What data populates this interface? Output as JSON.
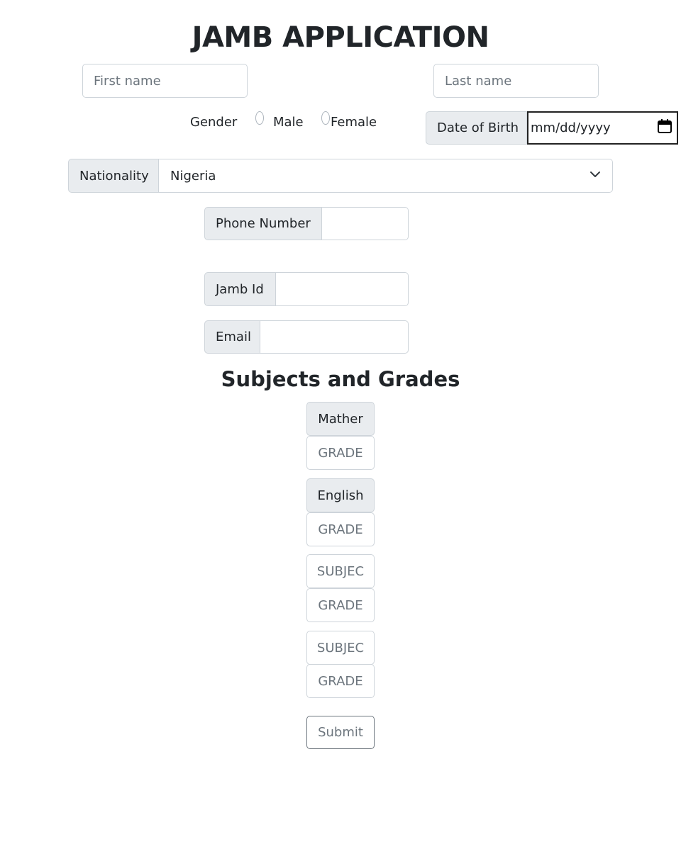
{
  "page": {
    "title": "JAMB APPLICATION",
    "subtitle": "Subjects and Grades"
  },
  "names": {
    "first_placeholder": "First name",
    "last_placeholder": "Last name"
  },
  "gender": {
    "label": "Gender",
    "options": [
      "Male",
      "Female"
    ]
  },
  "dob": {
    "label": "Date of Birth",
    "value": "mm/dd/yyyy",
    "icon": "calendar-icon"
  },
  "nationality": {
    "label": "Nationality",
    "selected": "Nigeria",
    "icon": "chevron-down-icon"
  },
  "phone": {
    "label": "Phone Number",
    "value": ""
  },
  "jamb": {
    "label": "Jamb Id",
    "value": ""
  },
  "email": {
    "label": "Email",
    "value": ""
  },
  "subjects": [
    {
      "subject": "Mather",
      "grade_placeholder": "GRADE"
    },
    {
      "subject": "English",
      "grade_placeholder": "GRADE"
    },
    {
      "subject_placeholder": "SUBJEC",
      "grade_placeholder": "GRADE"
    },
    {
      "subject_placeholder": "SUBJEC",
      "grade_placeholder": "GRADE"
    }
  ],
  "submit_label": "Submit",
  "colors": {
    "addon_bg": "#e9ecef",
    "border": "#ced4da",
    "placeholder": "#6c757d",
    "text": "#212529"
  }
}
